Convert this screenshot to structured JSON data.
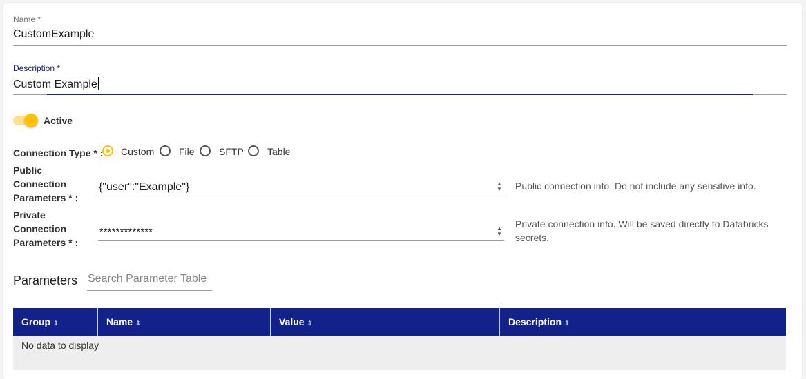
{
  "form": {
    "name": {
      "label": "Name *",
      "value": "CustomExample"
    },
    "description": {
      "label": "Description *",
      "value": "Custom Example"
    },
    "active": {
      "label": "Active",
      "on": true
    },
    "connection_type": {
      "label": "Connection Type * :",
      "options": [
        {
          "label": "Custom",
          "checked": true
        },
        {
          "label": "File",
          "checked": false
        },
        {
          "label": "SFTP",
          "checked": false
        },
        {
          "label": "Table",
          "checked": false
        }
      ]
    },
    "public_params": {
      "label_lines": [
        "Public",
        "Connection",
        "Parameters * :"
      ],
      "value": "{\"user\":\"Example\"}",
      "hint": "Public connection info. Do not include any sensitive info."
    },
    "private_params": {
      "label_lines": [
        "Private",
        "Connection",
        "Parameters * :"
      ],
      "value": "*************",
      "hint_lines": [
        "Private connection info. Will be saved directly to Databricks",
        "secrets."
      ]
    }
  },
  "parameters": {
    "title": "Parameters",
    "search_placeholder": "Search Parameter Table",
    "columns": [
      "Group",
      "Name",
      "Value",
      "Description"
    ],
    "empty_message": "No data to display"
  },
  "icons": {
    "sort": "sort-icon",
    "spin_up": "spin-up-icon",
    "spin_down": "spin-down-icon"
  },
  "colors": {
    "accent": "#ffc107",
    "primary": "#13218a",
    "focus_underline": "#1a237e"
  }
}
